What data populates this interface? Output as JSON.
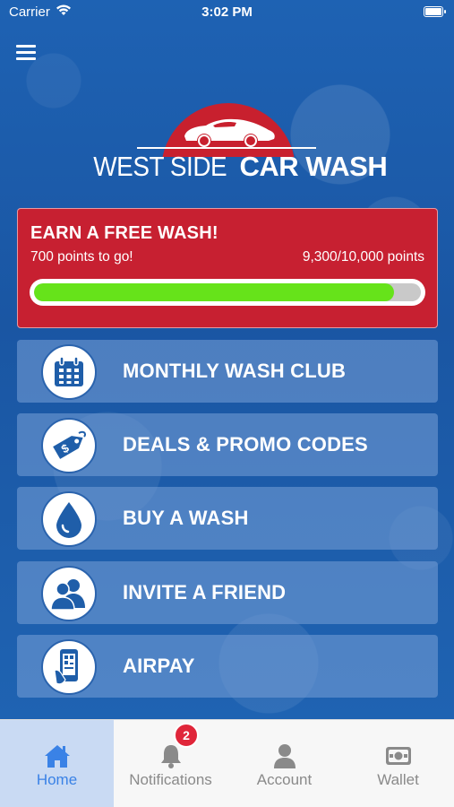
{
  "status_bar": {
    "carrier": "Carrier",
    "time": "3:02 PM"
  },
  "logo": {
    "word1": "WEST SIDE",
    "word2": "CAR WASH"
  },
  "rewards": {
    "title": "EARN A FREE WASH!",
    "points_to_go": "700 points to go!",
    "points_status": "9,300/10,000 points",
    "progress_fraction": 0.93
  },
  "menu": [
    {
      "label": "MONTHLY WASH CLUB",
      "icon": "calendar-icon"
    },
    {
      "label": "DEALS & PROMO CODES",
      "icon": "price-tag-icon"
    },
    {
      "label": "BUY A WASH",
      "icon": "water-drop-icon"
    },
    {
      "label": "INVITE A FRIEND",
      "icon": "people-icon"
    },
    {
      "label": "AIRPAY",
      "icon": "phone-pay-icon"
    }
  ],
  "tabs": [
    {
      "label": "Home",
      "icon": "home-icon",
      "active": true
    },
    {
      "label": "Notifications",
      "icon": "bell-icon",
      "badge": "2"
    },
    {
      "label": "Account",
      "icon": "person-icon"
    },
    {
      "label": "Wallet",
      "icon": "wallet-icon"
    }
  ],
  "colors": {
    "background_blue": "#1a5aa8",
    "brand_red": "#c72031",
    "progress_green": "#66e31a",
    "active_tab": "#3a82e6"
  }
}
